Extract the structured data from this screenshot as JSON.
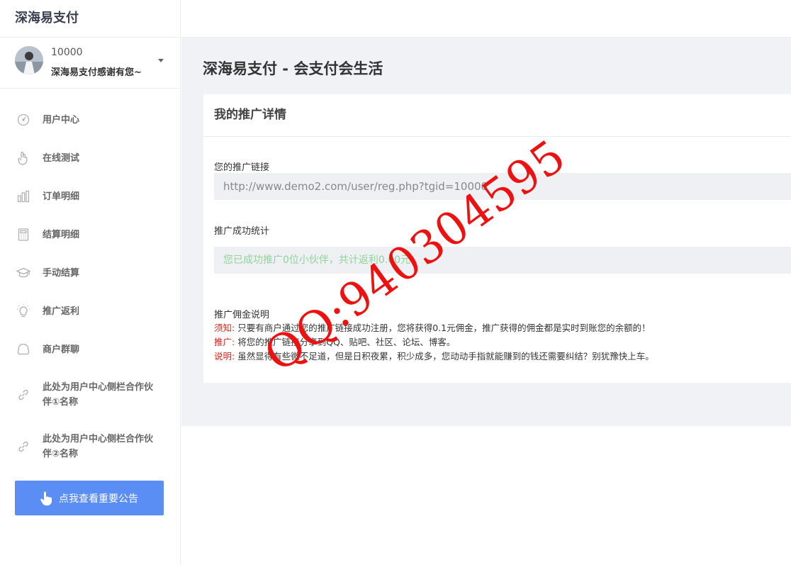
{
  "brand": "深海易支付",
  "user": {
    "id": "10000",
    "slogan": "深海易支付感谢有您~"
  },
  "nav": [
    {
      "icon": "dashboard-icon",
      "label": "用户中心"
    },
    {
      "icon": "hand-gesture-icon",
      "label": "在线测试"
    },
    {
      "icon": "bar-chart-icon",
      "label": "订单明细"
    },
    {
      "icon": "calculator-icon",
      "label": "结算明细"
    },
    {
      "icon": "graduation-cap-icon",
      "label": "手动结算"
    },
    {
      "icon": "lightbulb-icon",
      "label": "推广返利"
    },
    {
      "icon": "chat-bubble-icon",
      "label": "商户群聊"
    },
    {
      "icon": "link-icon",
      "label": "此处为用户中心侧栏合作伙伴①名称"
    },
    {
      "icon": "link-icon",
      "label": "此处为用户中心侧栏合作伙伴②名称"
    }
  ],
  "notice_button": "点我查看重要公告",
  "page_title": "深海易支付 - 会支付会生活",
  "card": {
    "title": "我的推广详情",
    "link_label": "您的推广链接",
    "link_value": "http://www.demo2.com/user/reg.php?tgid=10000",
    "stats_label": "推广成功统计",
    "stats_text": "您已成功推广0位小伙伴，共计返利0.00元",
    "rules_label": "推广佣金说明",
    "rules": [
      {
        "tag": "须知:",
        "text": "只要有商户通过您的推广链接成功注册，您将获得0.1元佣金，推广获得的佣金都是实时到账您的余额的！"
      },
      {
        "tag": "推广:",
        "text": "将您的推广链接分享到QQ、贴吧、社区、论坛、博客。"
      },
      {
        "tag": "说明:",
        "text": "虽然显得有些微不足道，但是日积夜累，积少成多，您动动手指就能赚到的钱还需要纠结？别犹豫快上车。"
      }
    ]
  },
  "watermark": "QQ:940304595",
  "colors": {
    "accent": "#5b8ef5",
    "success_text": "#8fd49a",
    "tag_red": "#d9261c",
    "watermark": "#ee1111"
  }
}
